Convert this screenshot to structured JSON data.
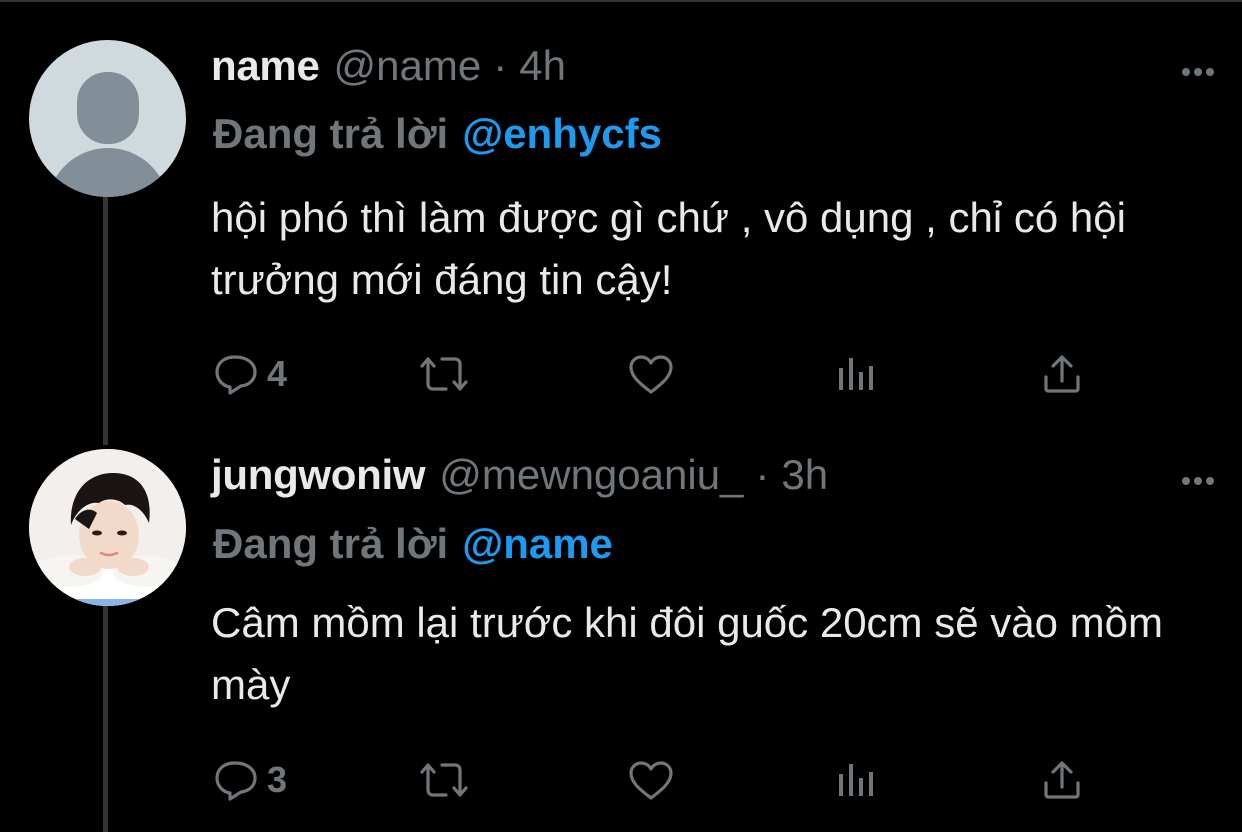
{
  "theme": {
    "background": "#000000",
    "text": "#e7e9ea",
    "muted": "#71767b",
    "accent": "#1d9bf0",
    "thread_line": "#333639"
  },
  "tweets": [
    {
      "display_name": "name",
      "handle": "@name",
      "separator": "·",
      "time": "4h",
      "replying_label": "Đang trả lời",
      "replying_to": "@enhycfs",
      "text": "hội phó thì làm được gì chứ , vô dụng , chỉ có hội trưởng mới đáng tin cậy!",
      "avatar": "default-avatar",
      "actions": {
        "reply_icon": "reply-icon",
        "reply_count": "4",
        "retweet_icon": "retweet-icon",
        "like_icon": "heart-icon",
        "views_icon": "analytics-icon",
        "share_icon": "share-icon"
      },
      "more_icon": "more-icon"
    },
    {
      "display_name": "jungwoniw",
      "handle": "@mewngoaniu_",
      "separator": "·",
      "time": "3h",
      "replying_label": "Đang trả lời",
      "replying_to": "@name",
      "text": "Câm mồm lại trước khi đôi guốc 20cm sẽ vào mồm mày",
      "avatar": "profile-photo",
      "actions": {
        "reply_icon": "reply-icon",
        "reply_count": "3",
        "retweet_icon": "retweet-icon",
        "like_icon": "heart-icon",
        "views_icon": "analytics-icon",
        "share_icon": "share-icon"
      },
      "more_icon": "more-icon"
    }
  ]
}
